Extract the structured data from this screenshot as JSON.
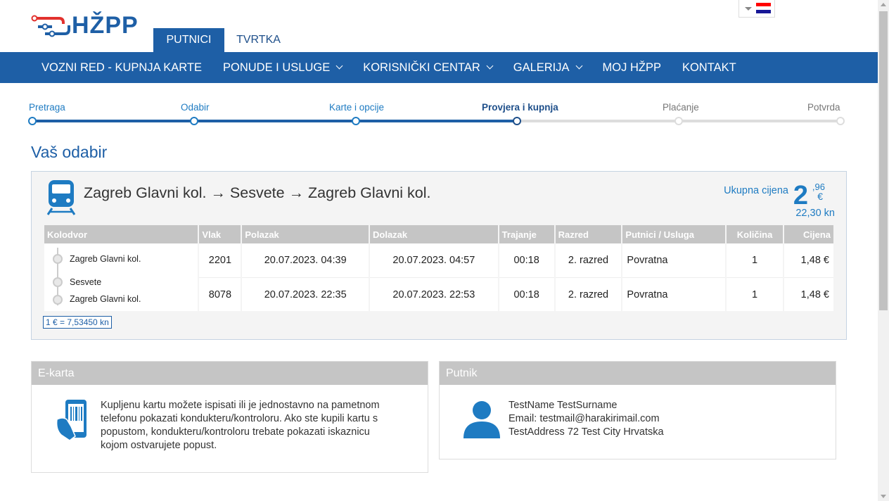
{
  "header": {
    "logo_text": "HŽPP",
    "tabs": [
      {
        "label": "PUTNICI",
        "active": true
      },
      {
        "label": "TVRTKA",
        "active": false
      }
    ],
    "flag_colors": [
      "#ff0000",
      "#ffffff",
      "#171796"
    ]
  },
  "nav": {
    "items": [
      {
        "label": "VOZNI RED - KUPNJA KARTE",
        "dropdown": false
      },
      {
        "label": "PONUDE I USLUGE",
        "dropdown": true
      },
      {
        "label": "KORISNIČKI CENTAR",
        "dropdown": true
      },
      {
        "label": "GALERIJA",
        "dropdown": true
      },
      {
        "label": "MOJ HŽPP",
        "dropdown": false
      },
      {
        "label": "KONTAKT",
        "dropdown": false
      }
    ]
  },
  "steps": [
    {
      "label": "Pretraga",
      "state": "done"
    },
    {
      "label": "Odabir",
      "state": "done"
    },
    {
      "label": "Karte i opcije",
      "state": "done"
    },
    {
      "label": "Provjera i kupnja",
      "state": "current"
    },
    {
      "label": "Plaćanje",
      "state": "todo"
    },
    {
      "label": "Potvrda",
      "state": "todo"
    }
  ],
  "page_title": "Vaš odabir",
  "summary": {
    "route": "Zagreb Glavni kol. → Sesvete → Zagreb Glavni kol.",
    "total_label": "Ukupna cijena",
    "total_int": "2",
    "total_cents": ",96",
    "total_currency": "€",
    "total_kn": "22,30 kn",
    "columns": [
      "Kolodvor",
      "Vlak",
      "Polazak",
      "Dolazak",
      "Trajanje",
      "Razred",
      "Putnici / Usluga",
      "Količina",
      "Cijena"
    ],
    "stations": [
      "Zagreb Glavni kol.",
      "Sesvete",
      "Zagreb Glavni kol."
    ],
    "rows": [
      {
        "vlak": "2201",
        "polazak": "20.07.2023. 04:39",
        "dolazak": "20.07.2023. 04:57",
        "trajanje": "00:18",
        "razred": "2. razred",
        "usluga": "Povratna",
        "kolicina": "1",
        "cijena": "1,48 €"
      },
      {
        "vlak": "8078",
        "polazak": "20.07.2023. 22:35",
        "dolazak": "20.07.2023. 22:53",
        "trajanje": "00:18",
        "razred": "2. razred",
        "usluga": "Povratna",
        "kolicina": "1",
        "cijena": "1,48 €"
      }
    ],
    "rate": "1 € = 7,53450 kn"
  },
  "ekarta": {
    "title": "E-karta",
    "text": "Kupljenu kartu možete ispisati ili je jednostavno na pametnom telefonu pokazati kondukteru/kontroloru. Ako ste kupili kartu s popustom, kondukteru/kontroloru trebate pokazati iskaznicu kojom ostvarujete popust."
  },
  "putnik": {
    "title": "Putnik",
    "name": "TestName TestSurname",
    "email": "Email: testmail@harakirimail.com",
    "address": "TestAddress 72 Test City Hrvatska"
  },
  "colors": {
    "brand_blue": "#1e5fa6",
    "accent_blue": "#1e7bc2",
    "header_grey": "#c5c5c5",
    "logo_red": "#e2312d"
  }
}
